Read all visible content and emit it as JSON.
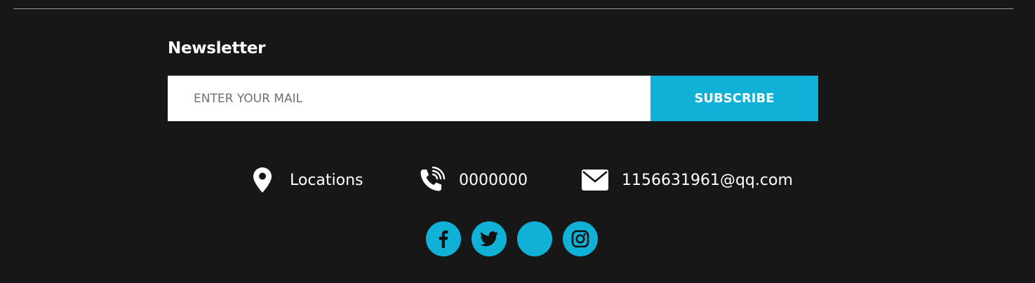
{
  "newsletter": {
    "title": "Newsletter",
    "input_placeholder": "ENTER YOUR MAIL",
    "input_value": "",
    "subscribe_label": "SUBSCRIBE"
  },
  "contacts": {
    "location": "Locations",
    "phone": "0000000",
    "email": "1156631961@qq.com"
  },
  "socials": [
    {
      "icon": "facebook-icon"
    },
    {
      "icon": "twitter-icon"
    },
    {
      "icon": "blank-icon"
    },
    {
      "icon": "instagram-icon"
    }
  ],
  "colors": {
    "background": "#171717",
    "accent": "#11b0d6",
    "text": "#ffffff",
    "divider": "#9a9a9a"
  }
}
